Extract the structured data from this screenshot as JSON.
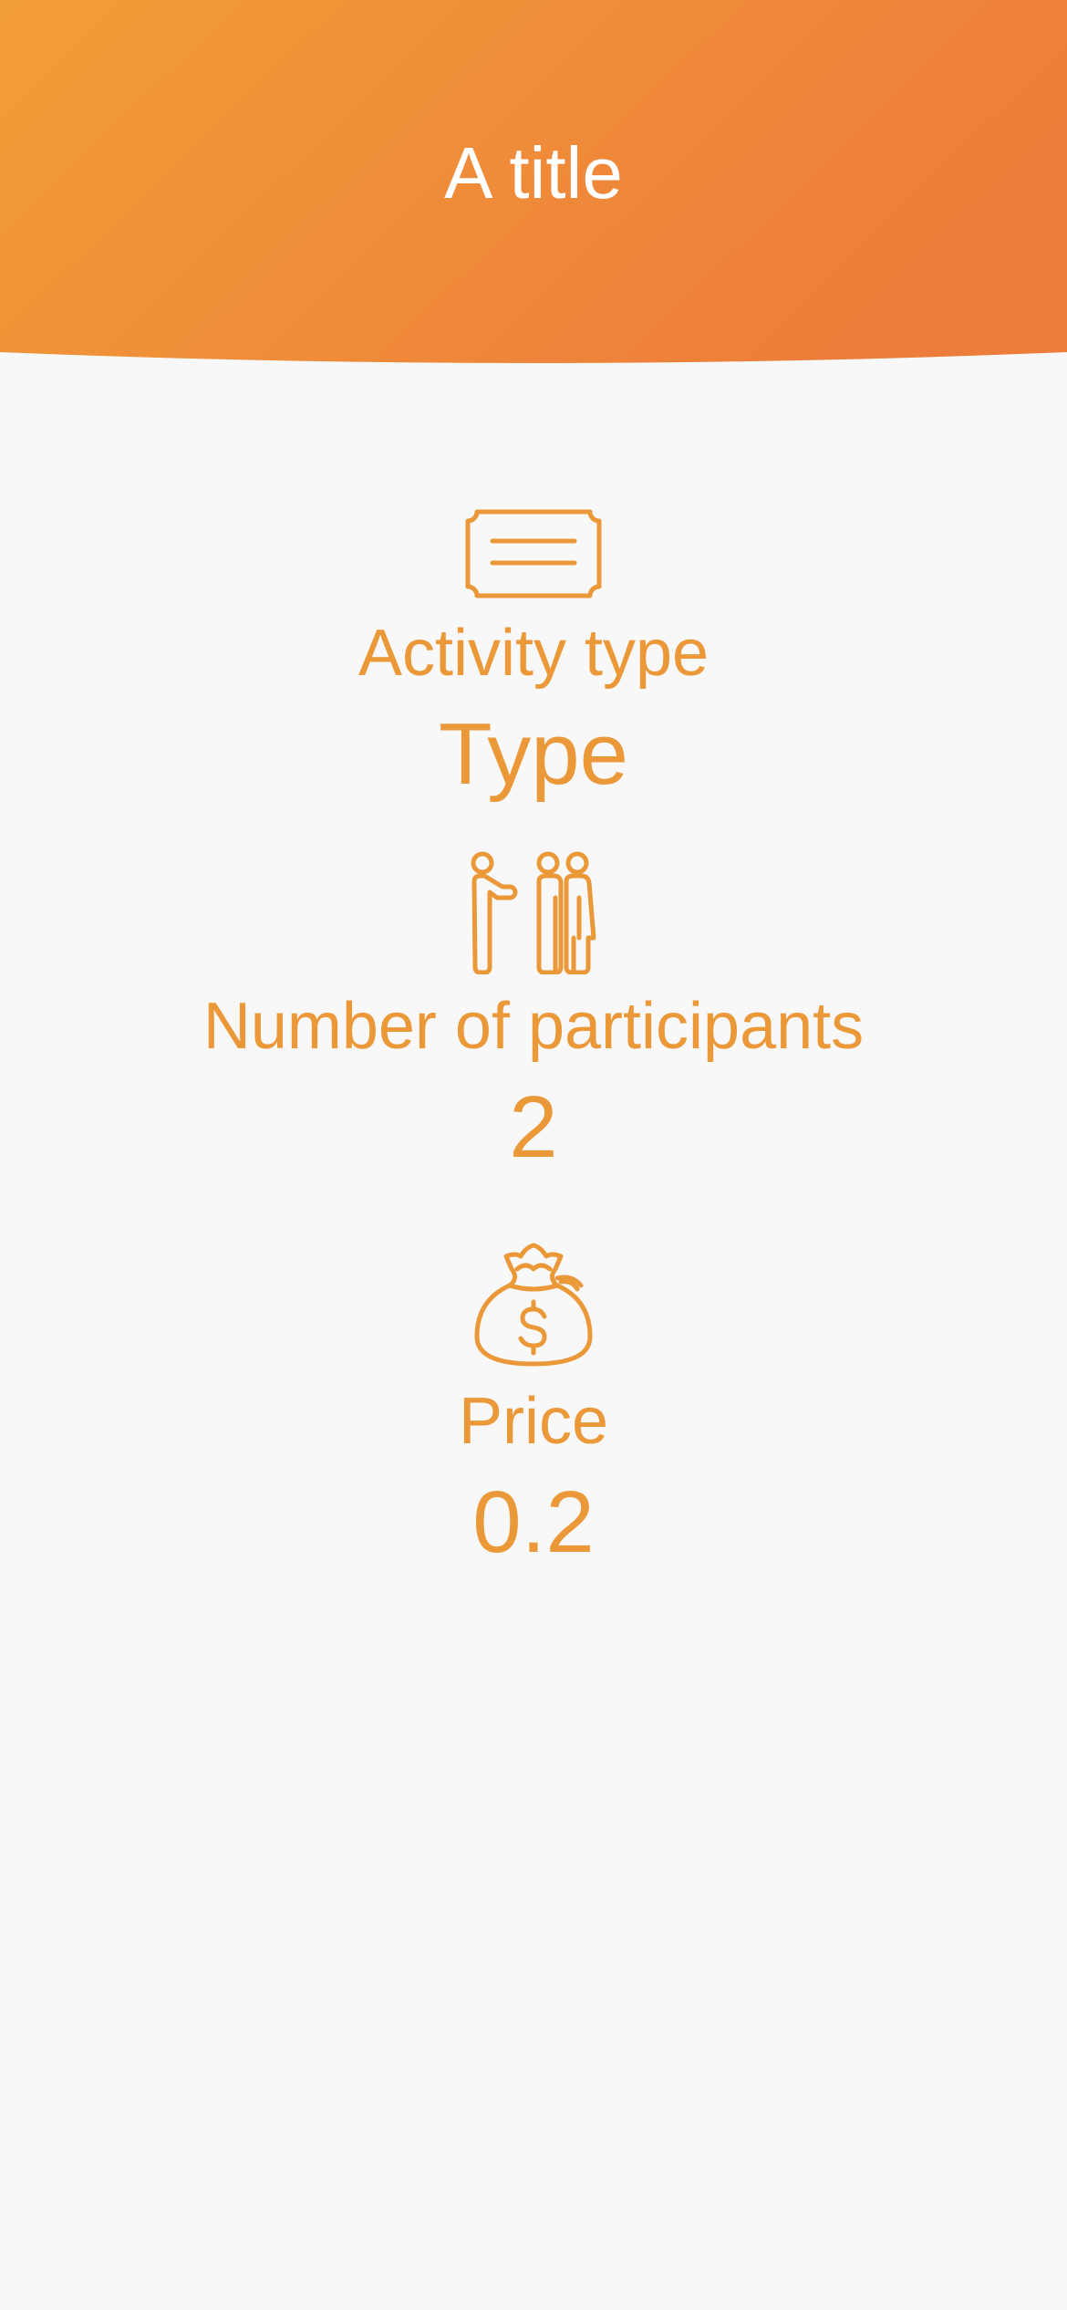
{
  "header": {
    "title": "A title",
    "gradient_start": "#f29e38",
    "gradient_end": "#ed7d3a"
  },
  "details": {
    "activity_type": {
      "icon": "ticket-icon",
      "label": "Activity type",
      "value": "Type"
    },
    "participants": {
      "icon": "people-icon",
      "label": "Number of participants",
      "value": "2"
    },
    "price": {
      "icon": "money-bag-icon",
      "label": "Price",
      "value": "0.2"
    }
  },
  "colors": {
    "accent": "#eb9838",
    "background": "#f8f8f8"
  }
}
